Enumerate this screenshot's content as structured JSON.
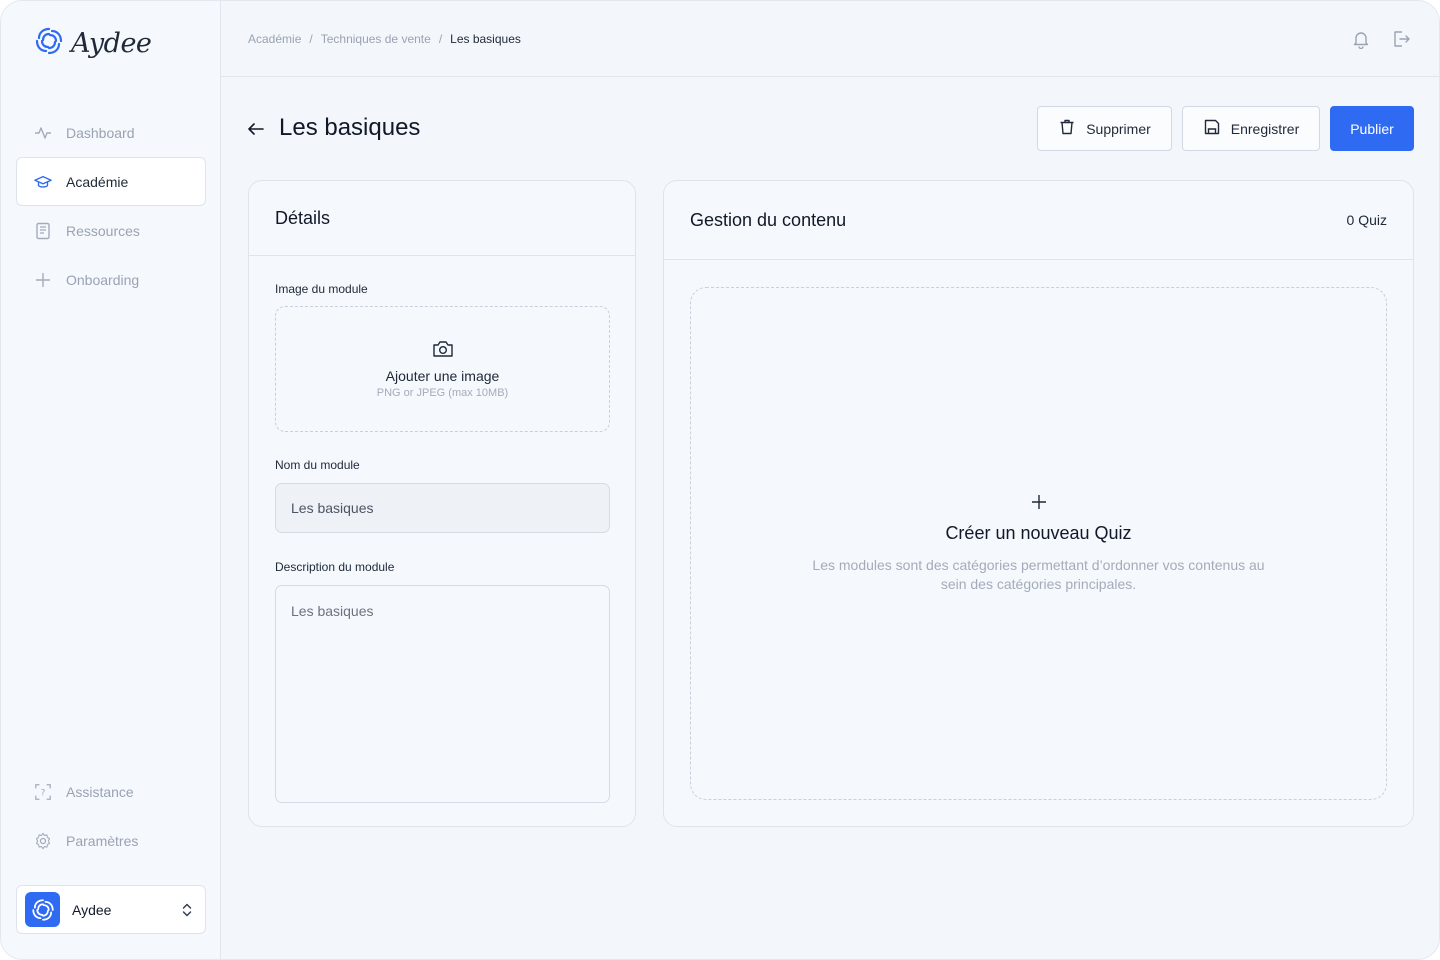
{
  "brand": {
    "name": "Aydee",
    "accent": "#2f6bf2"
  },
  "sidebar": {
    "items": [
      {
        "label": "Dashboard",
        "icon": "activity-icon",
        "active": false
      },
      {
        "label": "Académie",
        "icon": "graduation-cap-icon",
        "active": true
      },
      {
        "label": "Ressources",
        "icon": "notebook-icon",
        "active": false
      },
      {
        "label": "Onboarding",
        "icon": "plus-icon",
        "active": false
      }
    ],
    "bottom_items": [
      {
        "label": "Assistance",
        "icon": "help-frame-icon"
      },
      {
        "label": "Paramètres",
        "icon": "gear-icon"
      }
    ],
    "account": {
      "name": "Aydee"
    }
  },
  "breadcrumb": {
    "items": [
      "Académie",
      "Techniques de vente",
      "Les basiques"
    ],
    "separator": "/"
  },
  "page": {
    "title": "Les basiques",
    "actions": {
      "delete_label": "Supprimer",
      "save_label": "Enregistrer",
      "publish_label": "Publier"
    }
  },
  "details": {
    "title": "Détails",
    "image_label": "Image du module",
    "image_cta": "Ajouter une image",
    "image_hint": "PNG or JPEG (max 10MB)",
    "name_label": "Nom du module",
    "name_value": "Les basiques",
    "description_label": "Description du module",
    "description_value": "Les basiques"
  },
  "content": {
    "title": "Gestion du contenu",
    "quiz_count": "0 Quiz",
    "empty_title": "Créer un nouveau Quiz",
    "empty_description": "Les modules sont des catégories permettant d’ordonner vos contenus au sein des catégories principales."
  }
}
